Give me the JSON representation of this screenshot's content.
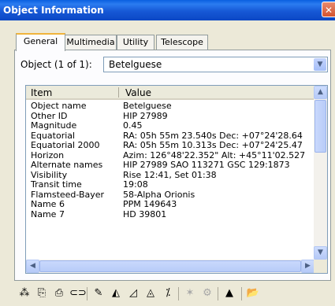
{
  "window": {
    "title": "Object Information",
    "close": "✕"
  },
  "tabs": [
    "General",
    "Multimedia",
    "Utility",
    "Telescope"
  ],
  "object": {
    "label": "Object (1 of 1):",
    "value": "Betelguese"
  },
  "table": {
    "headers": [
      "Item",
      "Value"
    ],
    "rows": [
      [
        "Object name",
        "Betelguese"
      ],
      [
        "Other ID",
        "HIP 27989"
      ],
      [
        "Magnitude",
        "0.45"
      ],
      [
        "Equatorial",
        "RA: 05h 55m 23.540s   Dec: +07°24'28.64"
      ],
      [
        "Equatorial 2000",
        "RA: 05h 55m 10.313s   Dec: +07°24'25.47"
      ],
      [
        "Horizon",
        "Azim: 126°48'22.352\"   Alt: +45°11'02.527"
      ],
      [
        "Alternate names",
        "HIP 27989  SAO 113271  GSC 129:1873"
      ],
      [
        "Visibility",
        "Rise 12:41,  Set 01:38"
      ],
      [
        "Transit time",
        "19:08"
      ],
      [
        "Flamsteed-Bayer",
        "58-Alpha Orionis"
      ],
      [
        "Name 6",
        "PPM 149643"
      ],
      [
        "Name 7",
        "HD 39801"
      ]
    ]
  },
  "toolbar": {
    "icons": [
      "stars-icon",
      "copy-icon",
      "print-icon",
      "link-icon",
      "chart-icon-1",
      "chart-icon-2",
      "chart-icon-3",
      "chart-icon-4",
      "chart-icon-5",
      "telescope-icon",
      "settings-icon",
      "up-arrow-icon",
      "folder-open-icon"
    ],
    "glyphs": [
      "⁂",
      "⎘",
      "⎙",
      "⊂⊃",
      "✎",
      "◭",
      "◿",
      "◬",
      "⁒",
      "✶",
      "⚙",
      "▲",
      "📂"
    ]
  }
}
